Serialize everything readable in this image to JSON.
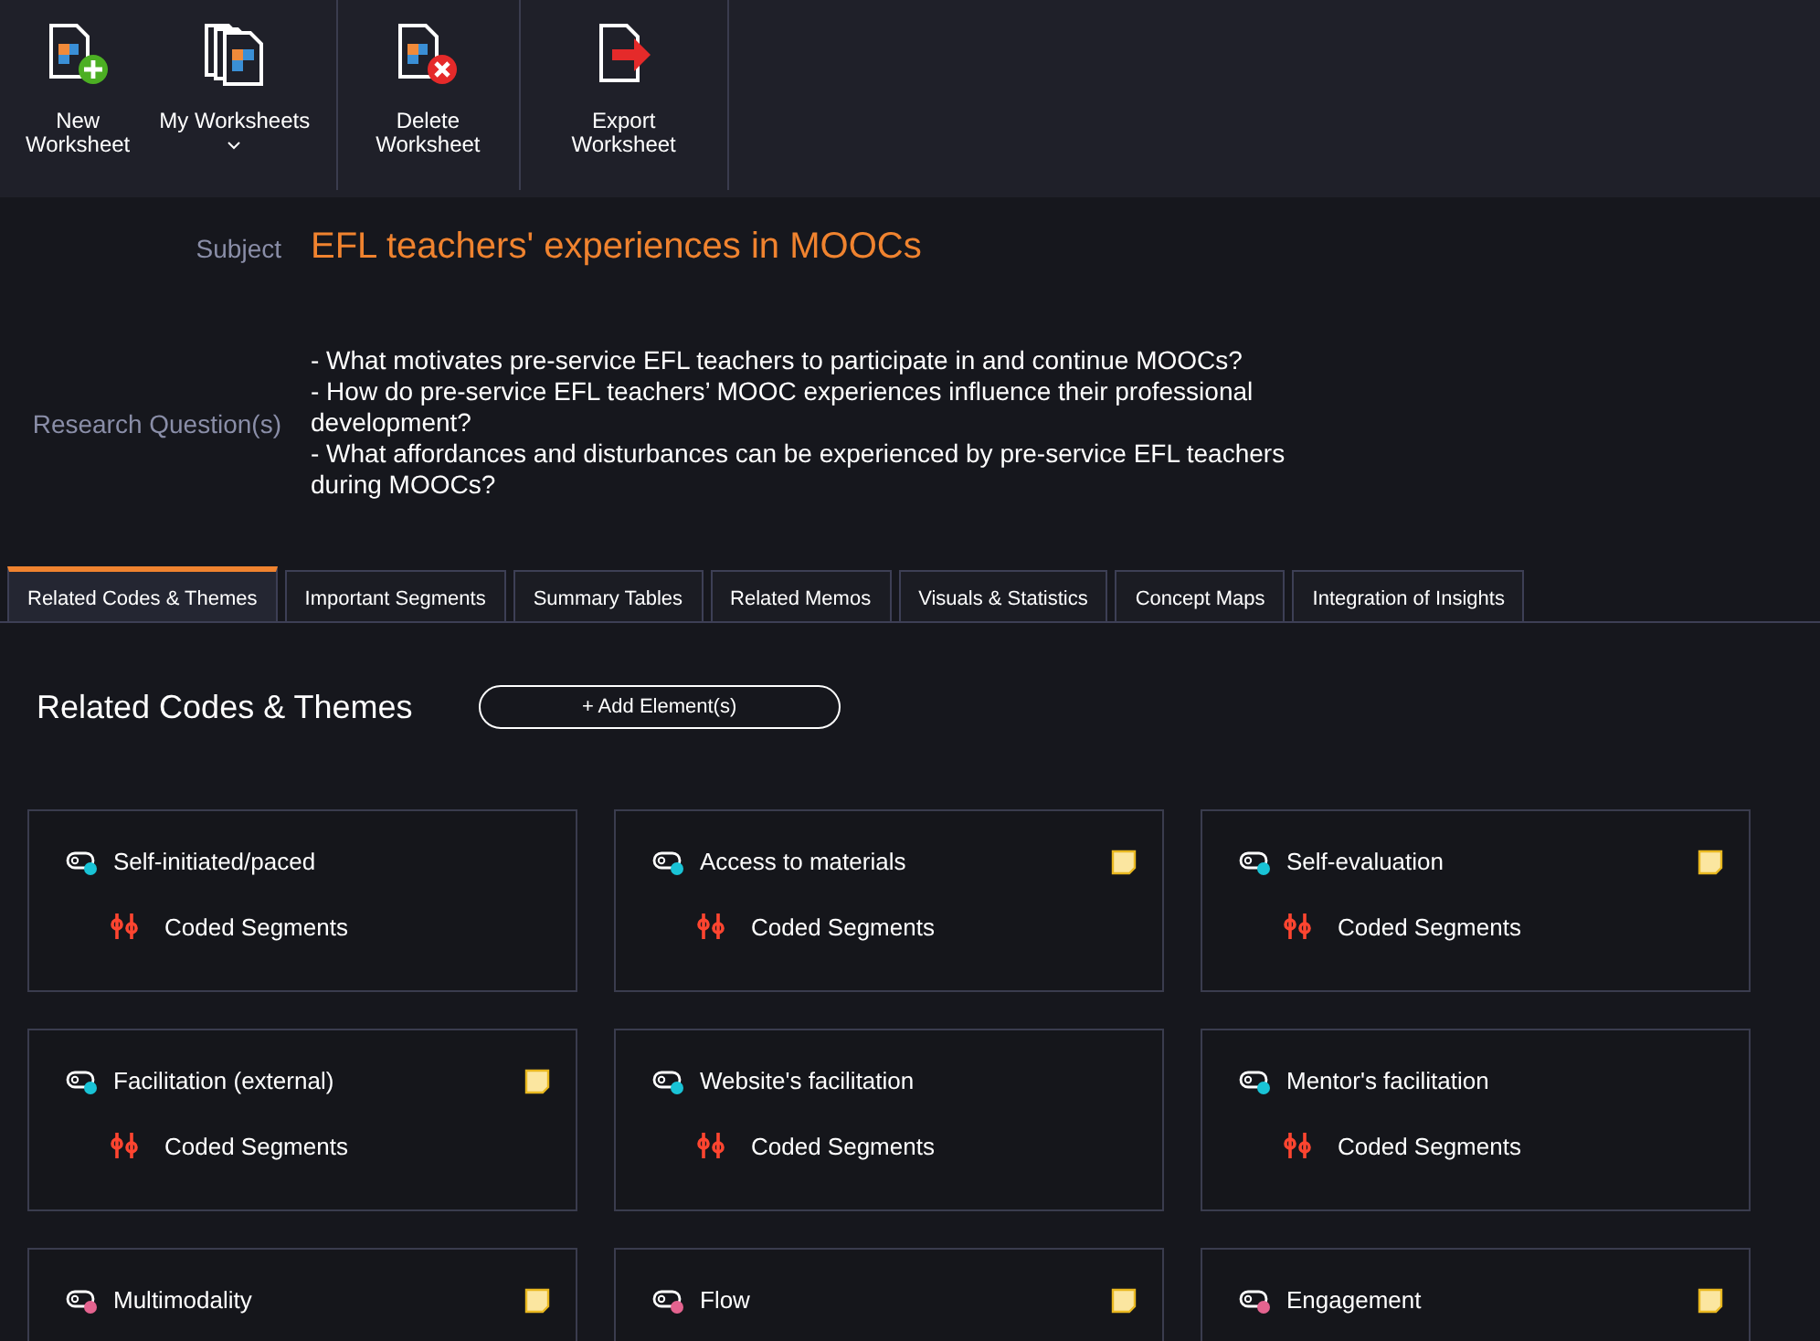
{
  "toolbar": [
    {
      "kind": "new",
      "label": "New\nWorksheet",
      "dropdown": false
    },
    {
      "kind": "list",
      "label": "My Worksheets",
      "dropdown": true
    },
    {
      "kind": "delete",
      "label": "Delete\nWorksheet",
      "dropdown": false
    },
    {
      "kind": "export",
      "label": "Export\nWorksheet",
      "dropdown": false
    }
  ],
  "subject": {
    "label": "Subject",
    "value": "EFL teachers' experiences in MOOCs"
  },
  "research_questions": {
    "label": "Research Question(s)",
    "lines": [
      "- What motivates pre-service EFL teachers to participate in and continue MOOCs?",
      "- How do pre-service EFL teachers’ MOOC experiences influence their professional development?",
      "- What affordances and disturbances can be experienced by pre-service EFL teachers during MOOCs?"
    ]
  },
  "tabs": [
    {
      "label": "Related Codes & Themes",
      "selected": true
    },
    {
      "label": "Important Segments",
      "selected": false
    },
    {
      "label": "Summary Tables",
      "selected": false
    },
    {
      "label": "Related Memos",
      "selected": false
    },
    {
      "label": "Visuals & Statistics",
      "selected": false
    },
    {
      "label": "Concept Maps",
      "selected": false
    },
    {
      "label": "Integration of Insights",
      "selected": false
    }
  ],
  "section": {
    "title": "Related Codes & Themes",
    "add_button": "+ Add Element(s)"
  },
  "codes": [
    {
      "name": "Self-initiated/paced",
      "color": "#19c3d6",
      "memo": false,
      "segments": "Coded Segments"
    },
    {
      "name": "Access to materials",
      "color": "#19c3d6",
      "memo": true,
      "segments": "Coded Segments"
    },
    {
      "name": "Self-evaluation",
      "color": "#19c3d6",
      "memo": true,
      "segments": "Coded Segments"
    },
    {
      "name": "Facilitation (external)",
      "color": "#19c3d6",
      "memo": true,
      "segments": "Coded Segments"
    },
    {
      "name": "Website's facilitation",
      "color": "#19c3d6",
      "memo": false,
      "segments": "Coded Segments"
    },
    {
      "name": "Mentor's facilitation",
      "color": "#19c3d6",
      "memo": false,
      "segments": "Coded Segments"
    },
    {
      "name": "Multimodality",
      "color": "#e4638f",
      "memo": true
    },
    {
      "name": "Flow",
      "color": "#e4638f",
      "memo": true
    },
    {
      "name": "Engagement",
      "color": "#e4638f",
      "memo": true
    }
  ]
}
